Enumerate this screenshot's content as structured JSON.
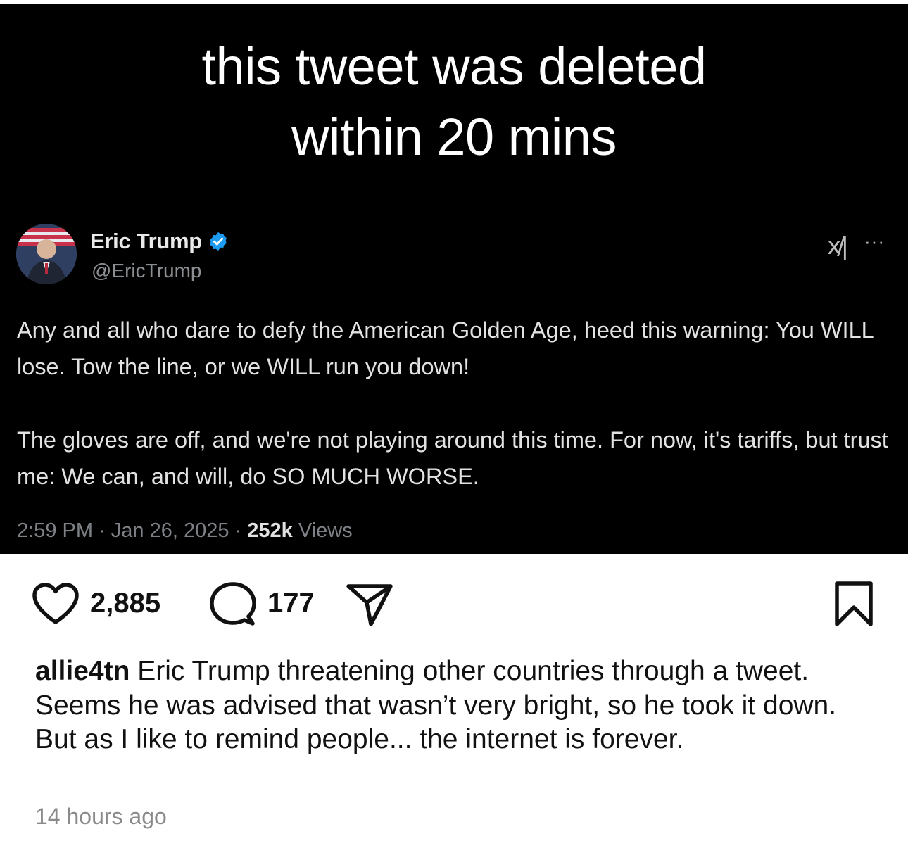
{
  "image": {
    "headline_line1": "this tweet was deleted",
    "headline_line2": "within 20 mins",
    "tweet": {
      "display_name": "Eric Trump",
      "handle": "@EricTrump",
      "paragraph1": "Any and all who dare to defy the American Golden Age, heed this warning: You WILL lose. Tow the line, or we WILL run you down!",
      "paragraph2": "The gloves are off, and we're not playing around this time. For now, it's tariffs, but trust me: We can, and will, do SO MUCH WORSE.",
      "time_date": "2:59 PM · Jan 26, 2025 · ",
      "views_count": "252k",
      "views_label": " Views",
      "x_logo": "x",
      "more_label": "···"
    }
  },
  "actions": {
    "like_count": "2,885",
    "comment_count": "177"
  },
  "caption": {
    "username": "allie4tn",
    "text": " Eric Trump threatening other countries through a tweet. Seems he was advised that wasn’t very bright, so he took it down. But as I like to remind people... the internet is forever."
  },
  "timestamp": "14 hours ago",
  "icons": {
    "like": "heart-icon",
    "comment": "comment-bubble-icon",
    "share": "paper-plane-icon",
    "save": "bookmark-icon",
    "verified": "verified-badge-icon"
  },
  "colors": {
    "image_background": "#000000",
    "verified_blue": "#1d9bf0",
    "text_primary": "#111111",
    "timestamp_gray": "#8a8a8a"
  }
}
